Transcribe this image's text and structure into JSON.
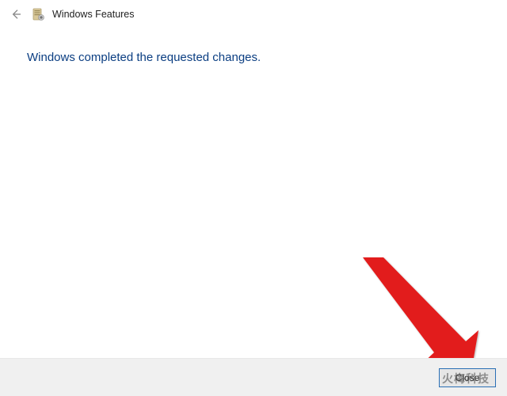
{
  "titlebar": {
    "title": "Windows Features"
  },
  "content": {
    "message": "Windows completed the requested changes."
  },
  "footer": {
    "close_label": "Close"
  },
  "watermark": {
    "text": "火梅科技"
  }
}
